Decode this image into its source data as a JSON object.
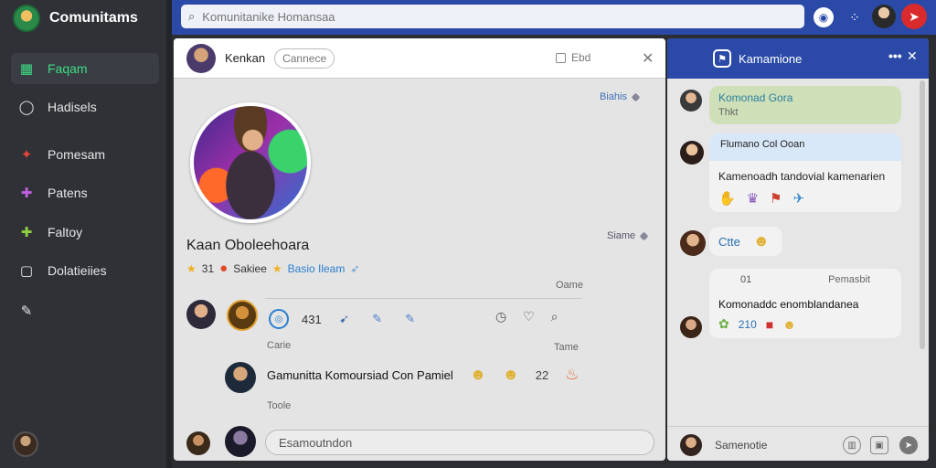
{
  "app": {
    "name": "Comunitams"
  },
  "sidebar": {
    "items": [
      {
        "label": "Faqam",
        "icon": "grid-icon",
        "active": true
      },
      {
        "label": "Hadisels",
        "icon": "chat-bubble-icon"
      },
      {
        "label": "Pomesam",
        "icon": "game-controller-icon"
      },
      {
        "label": "Patens",
        "icon": "puzzle-icon"
      },
      {
        "label": "Faltoy",
        "icon": "controller-icon"
      },
      {
        "label": "Dolatieiies",
        "icon": "document-icon"
      },
      {
        "label": "",
        "icon": "pin-icon"
      }
    ]
  },
  "topbar": {
    "search_placeholder": "Komunitanike Homansaa"
  },
  "main": {
    "header": {
      "name": "Kenkan",
      "pill": "Cannece",
      "meta": "Ebd",
      "close": "✕"
    },
    "tag_top": "Biahis",
    "tag_mid": "Siame",
    "profile": {
      "name": "Kaan Oboleehoara",
      "stat_count": "31",
      "stat_label": "Sakiee",
      "stat_blue": "Basio Ileam"
    },
    "label_game": "Oame",
    "actions": {
      "count": "431"
    },
    "label_carie": "Carie",
    "label_tame": "Tame",
    "comment": {
      "text": "Gamunitta Komoursiad Con Pamiel",
      "count": "22"
    },
    "label_tacie": "Toole",
    "compose_placeholder": "Esamoutndon"
  },
  "chat": {
    "title": "Kamamione",
    "messages": [
      {
        "title": "Komonad Gora",
        "sub": "Thkt"
      },
      {
        "title": "Flumano Col Ooan",
        "body": "Kamenoadh tandovial kamenarien"
      },
      {
        "body": "Ctte"
      },
      {
        "left": "01",
        "right": "Pemasbit",
        "body": "Komonaddc enomblandanea",
        "count": "210"
      }
    ],
    "footer_label": "Samenotie"
  },
  "colors": {
    "accent_blue": "#2b4aa8",
    "active_green": "#3ddc84",
    "sidebar_bg": "#2f3136"
  }
}
